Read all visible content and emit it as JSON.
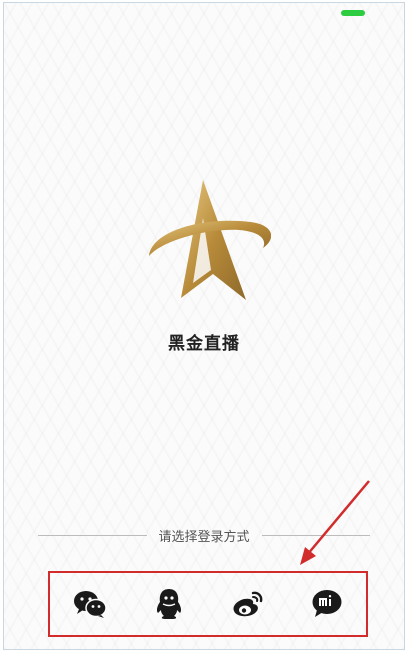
{
  "app": {
    "name": "黑金直播"
  },
  "login": {
    "prompt": "请选择登录方式",
    "methods": [
      {
        "id": "wechat",
        "icon": "wechat-icon"
      },
      {
        "id": "qq",
        "icon": "qq-icon"
      },
      {
        "id": "weibo",
        "icon": "weibo-icon"
      },
      {
        "id": "xiaomi",
        "icon": "xiaomi-icon"
      }
    ]
  },
  "colors": {
    "gold": "#c9a24e",
    "highlight_border": "#d12b2b",
    "battery": "#2ecc40",
    "icon": "#1a1a1a"
  }
}
